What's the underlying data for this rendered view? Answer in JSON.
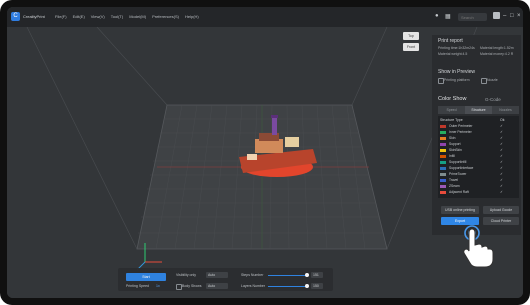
{
  "app": {
    "name": "CrealityPrint",
    "menu": [
      "File(F)",
      "Edit(E)",
      "View(V)",
      "Tool(T)",
      "Model(M)",
      "Preferences(S)",
      "Help(H)"
    ]
  },
  "topbar": {
    "search_placeholder": "Search",
    "icons": [
      "user-icon",
      "grid-icon",
      "minimize-icon",
      "maximize-icon",
      "close-icon"
    ]
  },
  "viewcube": {
    "top_label": "Top",
    "front_label": "Front"
  },
  "panel": {
    "report_title": "Print report",
    "report_lines": [
      "Printing time:1h32m24s",
      "Material length:1.52m",
      "Material weight:4.5",
      "Material money:4.2 R"
    ],
    "preview_title": "Show in Preview",
    "preview_options": [
      "Printing platform",
      "Nozzle"
    ],
    "color_show_title": "Color Show",
    "color_show_right": "G-Code",
    "tabs": [
      "Speed",
      "Structure",
      "Nozzles"
    ],
    "legend_header": [
      "Structure Type",
      "Ok"
    ],
    "legend": [
      {
        "label": "Outer Perimeter",
        "color": "#c0392b"
      },
      {
        "label": "Inner Perimeter",
        "color": "#27ae60"
      },
      {
        "label": "Skin",
        "color": "#e67e22"
      },
      {
        "label": "Support",
        "color": "#8e44ad"
      },
      {
        "label": "SkinSkin",
        "color": "#f1c40f"
      },
      {
        "label": "Infill",
        "color": "#d35400"
      },
      {
        "label": "SupportInfill",
        "color": "#16a085"
      },
      {
        "label": "SupportInterface",
        "color": "#2c6fb7"
      },
      {
        "label": "PrimeTower",
        "color": "#7f8c8d"
      },
      {
        "label": "Travel",
        "color": "#3a5fcd"
      },
      {
        "label": "ZSeam",
        "color": "#9b59b6"
      },
      {
        "label": "Adjacent Raft",
        "color": "#e74c3c"
      }
    ],
    "buttons": {
      "usb": "USB online printing",
      "upload": "Upload Gcode",
      "export": "Export",
      "cloud": "Cloud Printer"
    }
  },
  "bottom": {
    "play_label": "Start",
    "printing_speed_label": "Printing Speed",
    "printing_speed_value": "1x",
    "visibility_label": "Visibility only",
    "visibility_value": "Auto",
    "body_shows_label": "Body Shows",
    "body_shows_value": "Auto",
    "steps_label": "Steps Number",
    "steps_value": "151",
    "layers_label": "Layers Number",
    "layers_value": "150",
    "steps_fraction": 0.98,
    "layers_fraction": 0.98
  }
}
